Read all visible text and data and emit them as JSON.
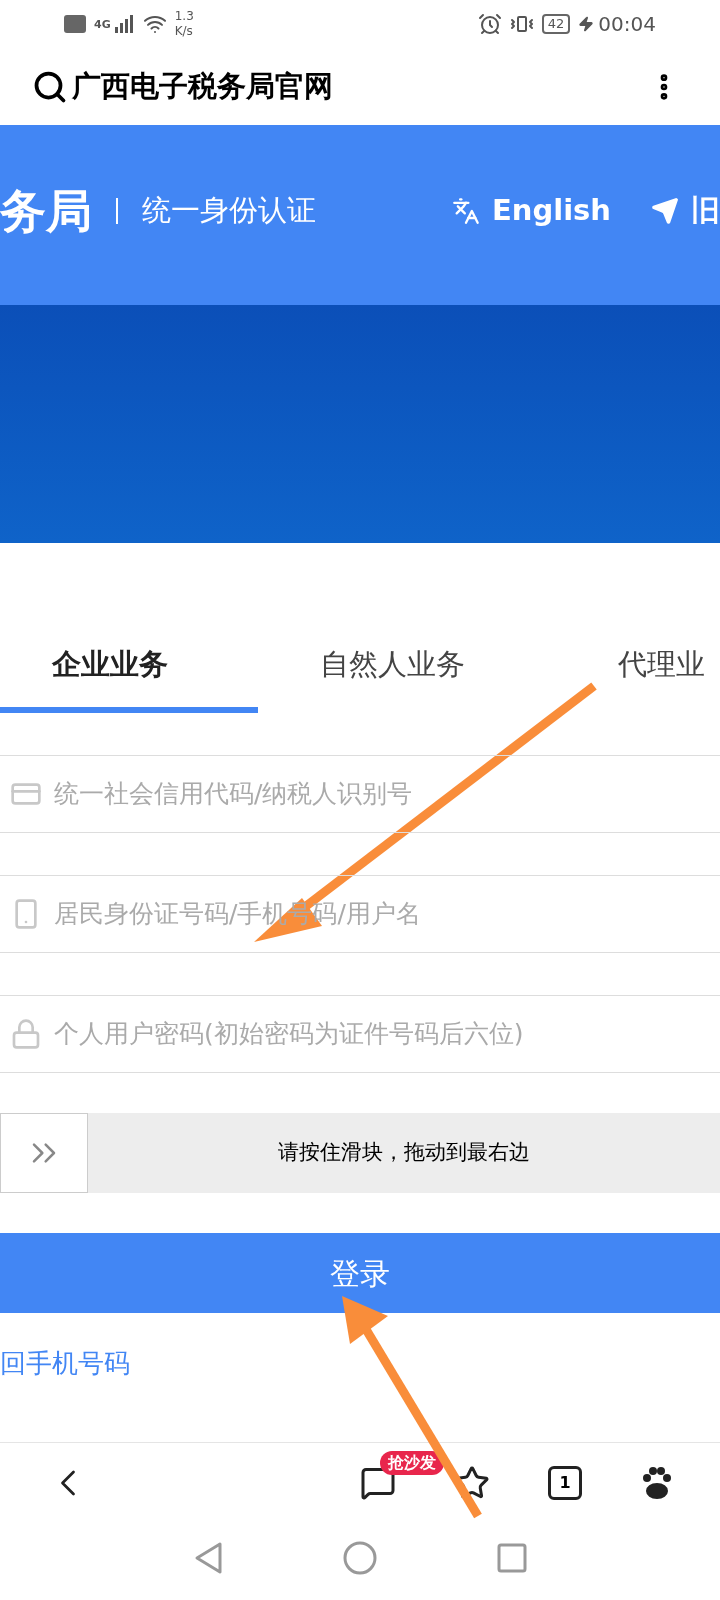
{
  "status_bar": {
    "network": "4G",
    "speed_value": "1.3",
    "speed_unit": "K/s",
    "battery": "42",
    "time": "00:04"
  },
  "address_bar": {
    "title": "广西电子税务局官网"
  },
  "header": {
    "site_name": "务局",
    "subtitle": "统一身份认证",
    "links": [
      {
        "kind": "language",
        "label": "English"
      },
      {
        "kind": "send",
        "label": "旧"
      }
    ]
  },
  "tabs": [
    {
      "label": "企业业务",
      "selected": true
    },
    {
      "label": "自然人业务",
      "selected": false
    },
    {
      "label": "代理业",
      "selected": false
    }
  ],
  "fields": [
    {
      "kind": "card",
      "placeholder": "统一社会信用代码/纳税人识别号"
    },
    {
      "kind": "phone",
      "placeholder": "居民身份证号码/手机号码/用户名"
    },
    {
      "kind": "lock",
      "placeholder": "个人用户密码(初始密码为证件号码后六位)"
    }
  ],
  "slider": {
    "label": "请按住滑块，拖动到最右边",
    "level": 0
  },
  "login_button": "登录",
  "link": "回手机号码",
  "browser_bar": {
    "badge": "抢沙发",
    "tab_count": "1"
  }
}
